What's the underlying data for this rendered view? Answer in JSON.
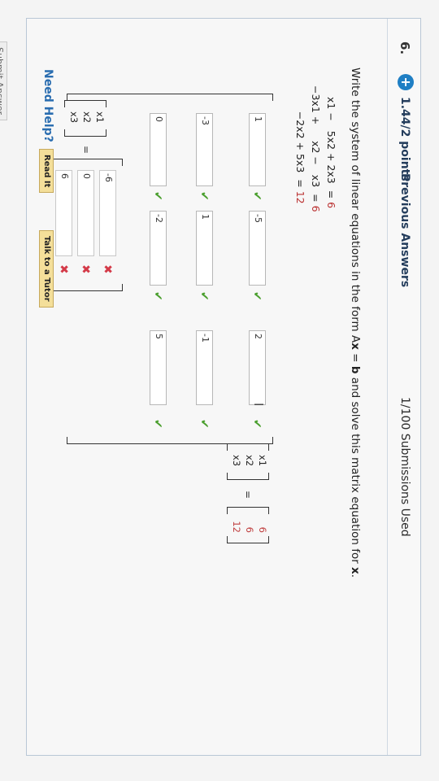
{
  "question": {
    "number": "6.",
    "points": "1.44/2 points",
    "previous_answers": "Previous Answers",
    "submissions": "1/100 Submissions Used",
    "prompt_prefix": "Write the system of linear equations in the form A",
    "prompt_x1": "x",
    "prompt_mid": " = ",
    "prompt_b": "b",
    "prompt_suffix": " and solve this matrix equation for ",
    "prompt_x2": "x",
    "prompt_end": "."
  },
  "equations": [
    {
      "lhs": "x1 −   5x2 + 2x3  =",
      "rhs": "6"
    },
    {
      "lhs": "−3x1 +     x2 −   x3  =",
      "rhs": "6"
    },
    {
      "lhs": "        −2x2 + 5x3  =",
      "rhs": "12"
    }
  ],
  "matrix_A": [
    [
      "1",
      "-5",
      "2"
    ],
    [
      "-3",
      "1",
      "-1"
    ],
    [
      "0",
      "-2",
      "5"
    ]
  ],
  "x_vector": [
    "x1",
    "x2",
    "x3"
  ],
  "b_vector": [
    "6",
    "6",
    "12"
  ],
  "solution_x_vector": [
    "x1",
    "x2",
    "x3"
  ],
  "solution_cells": [
    "-6",
    "0",
    "6"
  ],
  "equals": "=",
  "help": {
    "need_help": "Need Help?",
    "read_it": "Read It",
    "talk_to_tutor": "Talk to a Tutor"
  },
  "submit_label": "Submit Answer",
  "icons": {
    "plus": "+",
    "correct": "✔",
    "incorrect": "✖",
    "text_cursor": "I"
  },
  "colors": {
    "accent": "#1f7fc4",
    "correct": "#4a9f2e",
    "incorrect": "#d43a48",
    "link": "#2a6db0"
  }
}
